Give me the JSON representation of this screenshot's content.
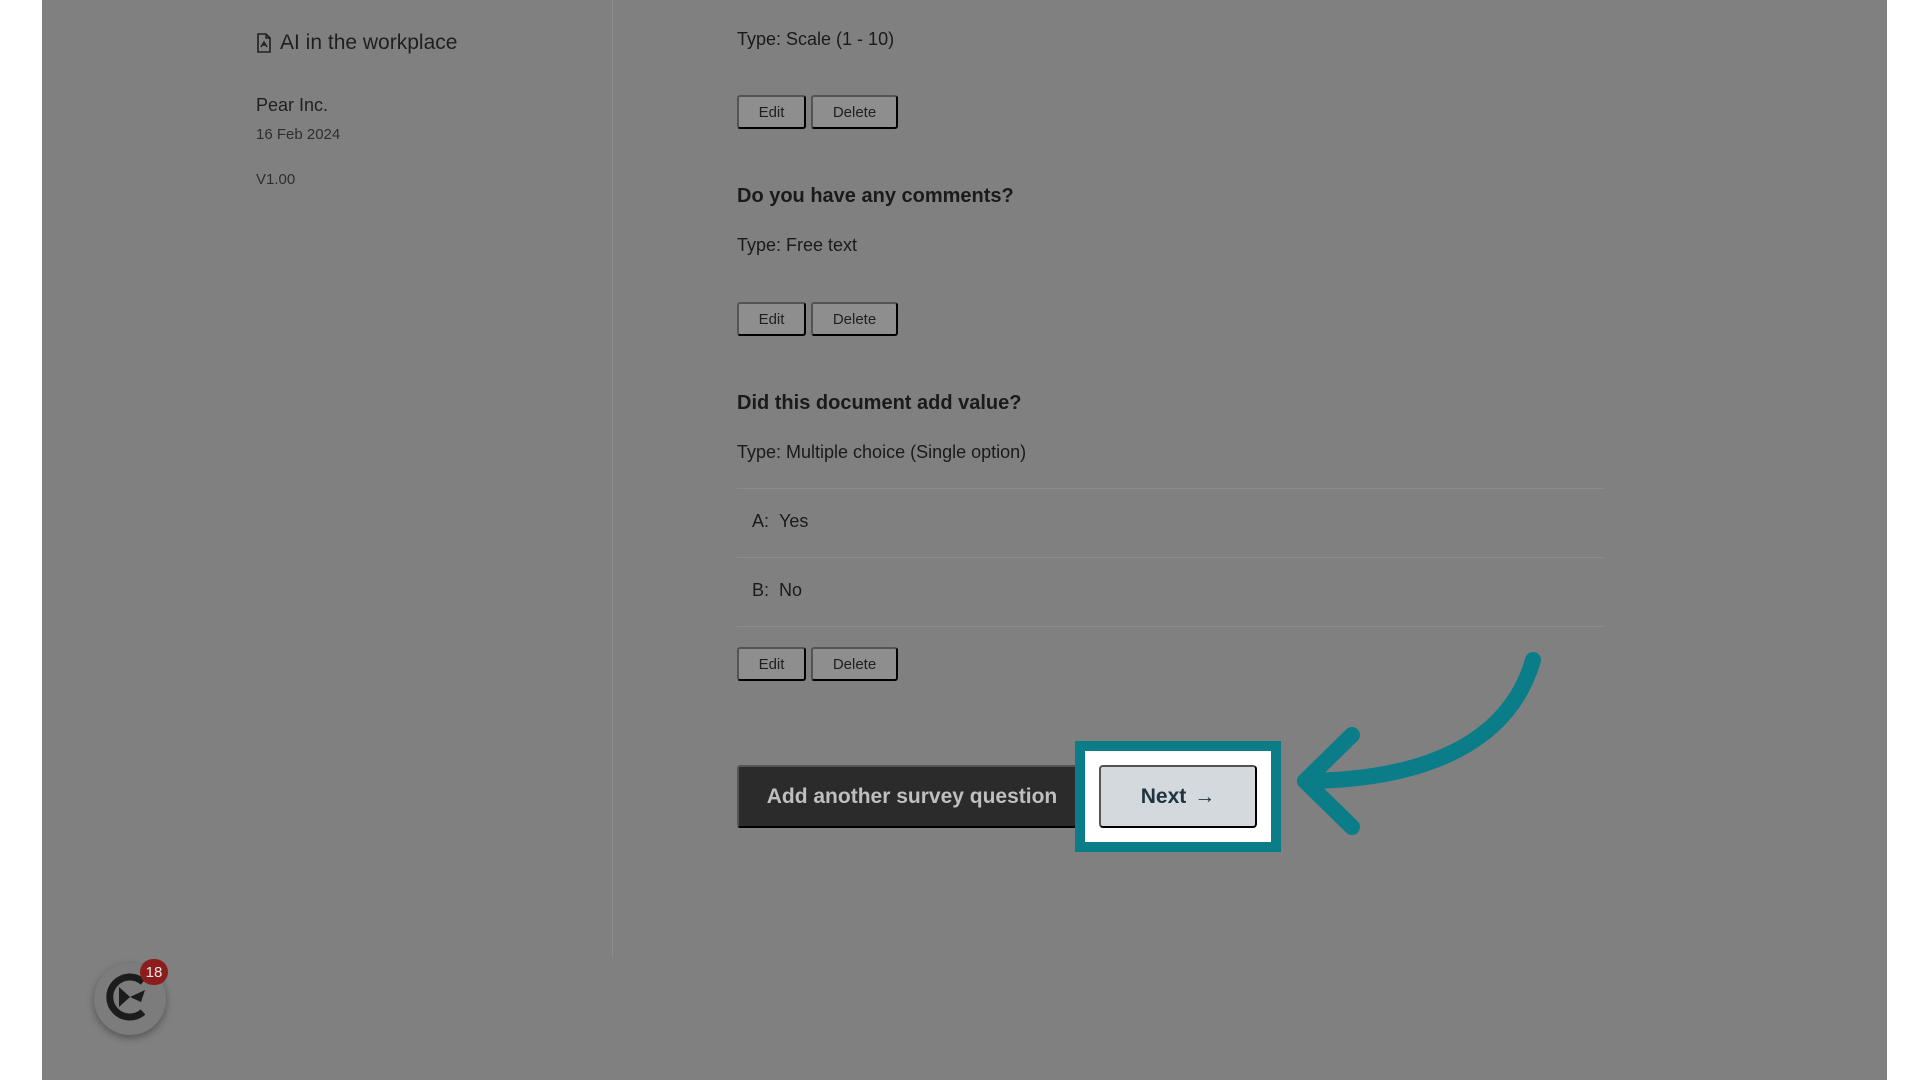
{
  "sidebar": {
    "doc_title": "AI in the workplace",
    "organization": "Pear Inc.",
    "date": "16 Feb 2024",
    "version": "V1.00"
  },
  "questions": [
    {
      "title": "",
      "type": "Type: Scale (1 - 10)",
      "edit_label": "Edit",
      "delete_label": "Delete"
    },
    {
      "title": "Do you have any comments?",
      "type": "Type: Free text",
      "edit_label": "Edit",
      "delete_label": "Delete"
    },
    {
      "title": "Did this document add value?",
      "type": "Type: Multiple choice (Single option)",
      "options": [
        {
          "letter": "A:",
          "text": "Yes"
        },
        {
          "letter": "B:",
          "text": "No"
        }
      ],
      "edit_label": "Edit",
      "delete_label": "Delete"
    }
  ],
  "actions": {
    "add_question_label": "Add another survey question",
    "next_label": "Next",
    "next_arrow": "→"
  },
  "launcher": {
    "badge_count": "18",
    "icon": "app-logo-icon"
  },
  "colors": {
    "highlight": "#0b7d89",
    "overlay": "#808080",
    "badge": "#8c1d1d"
  }
}
